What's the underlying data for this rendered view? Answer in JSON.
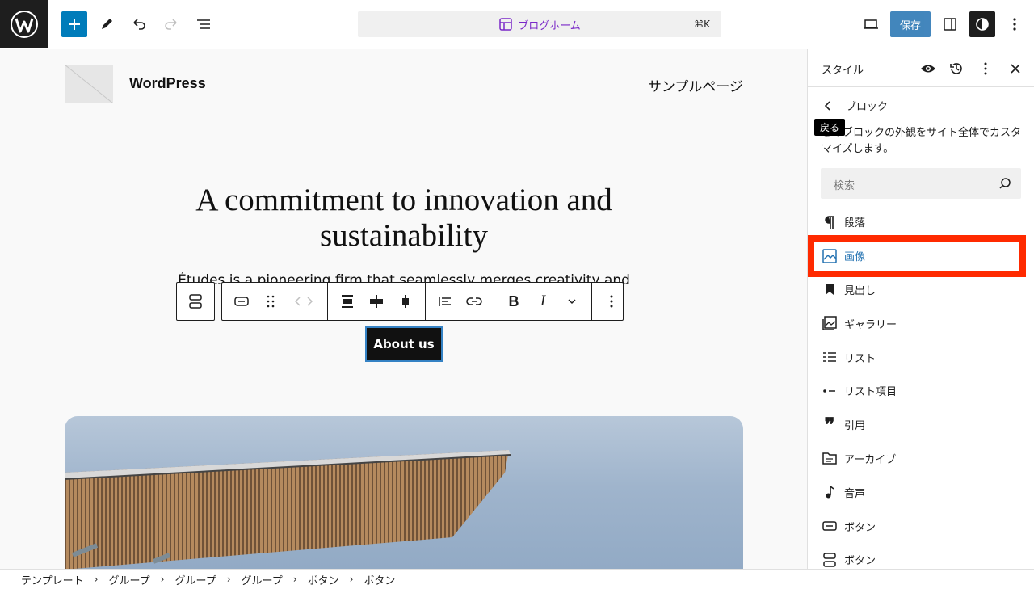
{
  "topbar": {
    "command_label": "ブログホーム",
    "shortcut": "⌘K",
    "save_label": "保存"
  },
  "site": {
    "title": "WordPress",
    "nav_item": "サンプルページ"
  },
  "hero": {
    "title": "A commitment to innovation and sustainability",
    "text": "Études is a pioneering firm that seamlessly merges creativity and",
    "button": "About us"
  },
  "sidebar": {
    "title": "スタイル",
    "back_label": "ブロック",
    "tooltip": "戻る",
    "description": "このブロックの外観をサイト全体でカスタマイズします。",
    "search_placeholder": "検索",
    "items": [
      {
        "label": "段落",
        "icon": "paragraph-icon"
      },
      {
        "label": "画像",
        "icon": "image-icon"
      },
      {
        "label": "見出し",
        "icon": "bookmark-icon"
      },
      {
        "label": "ギャラリー",
        "icon": "gallery-icon"
      },
      {
        "label": "リスト",
        "icon": "list-icon"
      },
      {
        "label": "リスト項目",
        "icon": "list-item-icon"
      },
      {
        "label": "引用",
        "icon": "quote-icon"
      },
      {
        "label": "アーカイブ",
        "icon": "archive-icon"
      },
      {
        "label": "音声",
        "icon": "audio-icon"
      },
      {
        "label": "ボタン",
        "icon": "button-icon"
      },
      {
        "label": "ボタン",
        "icon": "buttons-icon"
      }
    ]
  },
  "breadcrumbs": [
    "テンプレート",
    "グループ",
    "グループ",
    "グループ",
    "ボタン",
    "ボタン"
  ],
  "colors": {
    "accent": "#2271b1",
    "highlight": "#ff2a00"
  }
}
